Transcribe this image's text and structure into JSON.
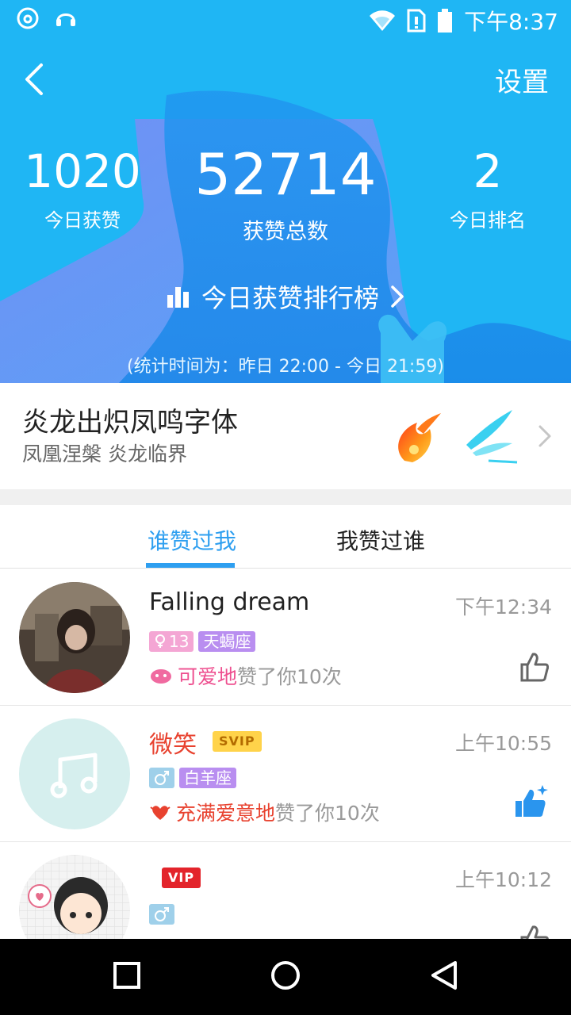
{
  "status_bar": {
    "time": "下午8:37",
    "icons": [
      "netease-music-icon",
      "headset-icon",
      "wifi-icon",
      "sim-alert-icon",
      "battery-icon"
    ]
  },
  "header": {
    "settings_label": "设置",
    "stats": [
      {
        "value": "1020",
        "label": "今日获赞"
      },
      {
        "value": "52714",
        "label": "获赞总数"
      },
      {
        "value": "2",
        "label": "今日排名"
      }
    ],
    "rank_link_label": "今日获赞排行榜",
    "stat_time": "(统计时间为：昨日 22:00 - 今日 21:59)",
    "colors": {
      "bg": "#1fb6f4",
      "accent": "#2e9ff0"
    }
  },
  "font_promo": {
    "title": "炎龙出炽凤鸣字体",
    "subtitle": "凤凰涅槃 炎龙临界"
  },
  "tabs": [
    {
      "label": "谁赞过我",
      "active": true
    },
    {
      "label": "我赞过谁",
      "active": false
    }
  ],
  "likes": [
    {
      "name": "Falling  dream",
      "time": "下午12:34",
      "gender_age": "13",
      "zodiac": "天蝎座",
      "adverb": "可爱地",
      "action": "赞了你10次"
    },
    {
      "name": "微笑",
      "badge": "SVIP",
      "time": "上午10:55",
      "zodiac": "白羊座",
      "adverb": "充满爱意地",
      "action": "赞了你10次"
    },
    {
      "badge": "VIP",
      "time": "上午10:12"
    }
  ]
}
